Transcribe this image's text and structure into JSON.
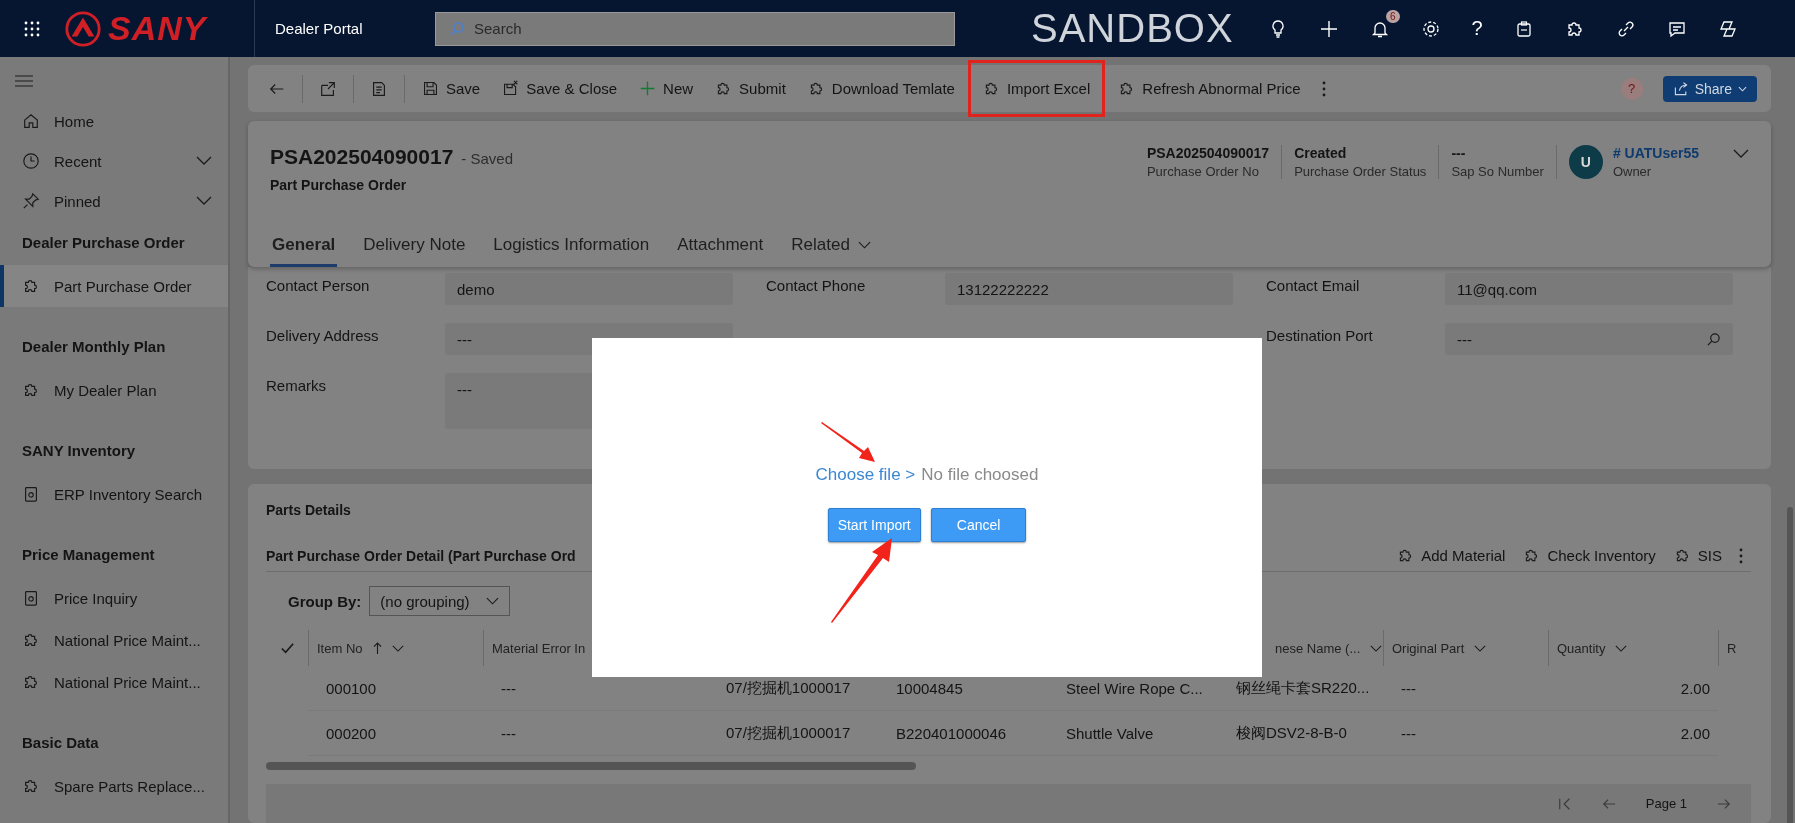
{
  "top_bar": {
    "logo_text": "SANY",
    "app_name": "Dealer Portal",
    "search": {
      "placeholder": "Search"
    },
    "environment": "SANDBOX",
    "notification_count": "6",
    "help": "?"
  },
  "sidebar": {
    "nav": [
      {
        "label": "Home",
        "kind": "home",
        "expandable": false
      },
      {
        "label": "Recent",
        "kind": "recent",
        "expandable": true
      },
      {
        "label": "Pinned",
        "kind": "pinned",
        "expandable": true
      }
    ],
    "groups": [
      {
        "title": "Dealer Purchase Order",
        "items": [
          {
            "label": "Part Purchase Order",
            "kind": "entity",
            "selected": true
          }
        ]
      },
      {
        "title": "Dealer Monthly Plan",
        "items": [
          {
            "label": "My Dealer Plan",
            "kind": "entity",
            "selected": false
          }
        ]
      },
      {
        "title": "SANY Inventory",
        "items": [
          {
            "label": "ERP Inventory Search",
            "kind": "report",
            "selected": false
          }
        ]
      },
      {
        "title": "Price Management",
        "items": [
          {
            "label": "Price Inquiry",
            "kind": "report",
            "selected": false
          },
          {
            "label": "National Price Maint...",
            "kind": "entity",
            "selected": false
          },
          {
            "label": "National Price Maint...",
            "kind": "entity",
            "selected": false
          }
        ]
      },
      {
        "title": "Basic Data",
        "items": [
          {
            "label": "Spare Parts Replace...",
            "kind": "entity",
            "selected": false
          }
        ]
      }
    ]
  },
  "command_bar": {
    "buttons": [
      {
        "label": "Save",
        "kind": "save",
        "highlighted": false
      },
      {
        "label": "Save & Close",
        "kind": "save-close",
        "highlighted": false
      },
      {
        "label": "New",
        "kind": "new",
        "highlighted": false
      },
      {
        "label": "Submit",
        "kind": "plugin",
        "highlighted": false
      },
      {
        "label": "Download Temlate",
        "kind": "plugin",
        "highlighted": false
      },
      {
        "label": "Import Excel",
        "kind": "plugin",
        "highlighted": true
      },
      {
        "label": "Refresh Abnormal Price",
        "kind": "plugin",
        "highlighted": false
      }
    ],
    "help": "?",
    "share": "Share"
  },
  "record": {
    "id": "PSA202504090017",
    "status": "- Saved",
    "entity": "Part Purchase Order",
    "fields": [
      {
        "value": "PSA202504090017",
        "label": "Purchase Order No"
      },
      {
        "value": "Created",
        "label": "Purchase Order Status"
      },
      {
        "value": "---",
        "label": "Sap So Number"
      }
    ],
    "owner": {
      "initial": "U",
      "name": "# UATUser55",
      "label": "Owner"
    }
  },
  "tabs": [
    {
      "label": "General",
      "selected": true,
      "menu": false
    },
    {
      "label": "Delivery Note",
      "selected": false,
      "menu": false
    },
    {
      "label": "Logistics Information",
      "selected": false,
      "menu": false
    },
    {
      "label": "Attachment",
      "selected": false,
      "menu": false
    },
    {
      "label": "Related",
      "selected": false,
      "menu": true
    }
  ],
  "form": {
    "rows": [
      [
        {
          "label": "Contact Person",
          "value": "demo",
          "kind": "text"
        },
        {
          "label": "Contact Phone",
          "value": "13122222222",
          "kind": "text"
        },
        {
          "label": "Contact Email",
          "value": "11@qq.com",
          "kind": "text"
        }
      ],
      [
        {
          "label": "Delivery Address",
          "value": "---",
          "kind": "text"
        },
        {
          "kind": "covered"
        },
        {
          "label": "Destination Port",
          "value": "---",
          "kind": "lookup"
        }
      ],
      [
        {
          "label": "Remarks",
          "value": "---",
          "kind": "multiline"
        }
      ]
    ]
  },
  "parts": {
    "title": "Parts Details",
    "grid_title": "Part Purchase Order Detail (Part Purchase Ord",
    "actions": [
      {
        "label": "Add Material"
      },
      {
        "label": "Check Inventory"
      },
      {
        "label": "SIS"
      }
    ],
    "group_by": {
      "label": "Group By:",
      "value": "(no grouping)"
    },
    "columns": [
      {
        "label": "Item No",
        "sorted": true,
        "menu": true
      },
      {
        "label": "Material Error In"
      },
      {},
      {},
      {},
      {
        "label": "nese Name (...",
        "sorted": false,
        "menu": true
      },
      {
        "label": "Original Part",
        "sorted": false,
        "menu": true
      },
      {
        "label": "Quantity",
        "sorted": false,
        "menu": true
      },
      {
        "label": "R"
      }
    ],
    "rows": [
      {
        "cells": [
          "000100",
          "---",
          "07/挖掘机1000017",
          "10004845",
          "Steel Wire Rope C...",
          "钢丝绳卡套SR220...",
          "---",
          "2.00"
        ]
      },
      {
        "cells": [
          "000200",
          "---",
          "07/挖掘机1000017",
          "B220401000046",
          "Shuttle Valve",
          "梭阀DSV2-8-B-0",
          "---",
          "2.00"
        ]
      }
    ],
    "page": "Page 1"
  },
  "dialog": {
    "choose": "Choose file >",
    "file": "No file choosed",
    "buttons": [
      "Start Import",
      "Cancel"
    ]
  }
}
